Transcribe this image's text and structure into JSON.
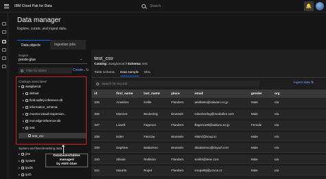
{
  "app": {
    "brand": "IBM Cloud Pak for Data",
    "search_placeholder": "Search"
  },
  "header": {
    "title": "Data manager",
    "subtitle": "Explore, curate, and ingest data."
  },
  "tabs": [
    "Data objects",
    "Ingestion jobs"
  ],
  "left": {
    "engine_label": "Engine",
    "engine_value": "presto-glue",
    "filter_placeholder": "Filter for tables",
    "create_label": "Create",
    "catalogs_label": "Catalogs associated",
    "tree": [
      {
        "label": "awsgluecat",
        "level": 0
      },
      {
        "label": "default",
        "level": 1
      },
      {
        "label": "field-safety-inference-db",
        "level": 1
      },
      {
        "label": "information_schema",
        "level": 1
      },
      {
        "label": "moomo-visual-inspection...",
        "level": 1
      },
      {
        "label": "mvi-edge-inference-db",
        "level": 1
      },
      {
        "label": "test",
        "level": 1
      },
      {
        "label": "test_csv",
        "level": 2
      }
    ],
    "system_label": "System and benchmarking data",
    "system_tree": [
      "jmx",
      "system",
      "tpcds",
      "tpch"
    ]
  },
  "annotation": {
    "line1": "Databases/tables managed",
    "line2": "by AWS Glue"
  },
  "right": {
    "title": "test_csv",
    "catalog_prefix": "Catalog:",
    "catalog_value": "awsgluecat",
    "schema_prefix": "/ Schema:",
    "schema_value": "test",
    "tabs": [
      "Table schema",
      "Data sample",
      "DDL"
    ],
    "filter_placeholder": "Search for records",
    "ingest_label": "Ingest data",
    "columns": [
      "id",
      "first_name",
      "last_name",
      "place",
      "email",
      "gender",
      "org"
    ],
    "rows": [
      [
        "335",
        "Anselma",
        "Kellie",
        "Flanders",
        "akellie8c@rakuten.co.jp",
        "Male",
        "n/a"
      ],
      [
        "336",
        "Marcien",
        "Beckerleg",
        "Brussels",
        "mbeckerleg@mediafire.com",
        "Male",
        "n/a"
      ],
      [
        "337",
        "Lowell",
        "Fagence",
        "Flanders",
        "lfagence9l@sakura.ne.jp",
        "Female",
        "n/a"
      ],
      [
        "338",
        "Eden",
        "Fairclay",
        "Brussels",
        "efaircl@soup.io",
        "Male",
        "n/a"
      ],
      [
        "339",
        "Daphine",
        "Battarisno",
        "Brussels",
        "dbattarisno@tinyurl.com",
        "Male",
        "n/a"
      ],
      [
        "340",
        "Silvain",
        "Reilinion",
        "Flanders",
        "sreilin@ieee.com",
        "Male",
        "n/a"
      ],
      [
        "341",
        "Maurits",
        "Rupel",
        "Flanders",
        "mrupel9j@ycoca.cz",
        "Male",
        "n/a"
      ]
    ]
  }
}
